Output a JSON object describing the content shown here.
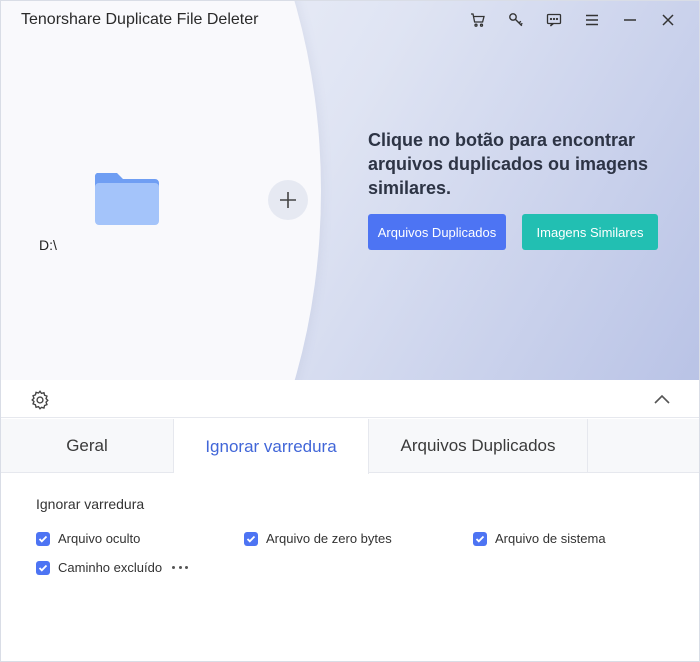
{
  "app": {
    "title": "Tenorshare Duplicate File Deleter"
  },
  "titlebar": {
    "icons": [
      "cart-icon",
      "key-icon",
      "feedback-icon",
      "menu-icon",
      "minimize-icon",
      "close-icon"
    ]
  },
  "source": {
    "drive_label": "D:\\"
  },
  "hero": {
    "headline": "Clique no botão para encontrar arquivos duplicados ou imagens similares.",
    "btn_duplicates": "Arquivos Duplicados",
    "btn_similar": "Imagens Similares"
  },
  "tabs": [
    {
      "label": "Geral",
      "active": false
    },
    {
      "label": "Ignorar varredura",
      "active": true
    },
    {
      "label": "Arquivos Duplicados",
      "active": false
    }
  ],
  "ignore_scan": {
    "title": "Ignorar varredura",
    "options": [
      {
        "label": "Arquivo oculto",
        "checked": true
      },
      {
        "label": "Arquivo de zero bytes",
        "checked": true
      },
      {
        "label": "Arquivo de sistema",
        "checked": true
      },
      {
        "label": "Caminho excluído",
        "checked": true
      }
    ]
  },
  "colors": {
    "primary_button": "#4d74f3",
    "secondary_button": "#22bfb2",
    "active_tab_text": "#4166d8"
  }
}
